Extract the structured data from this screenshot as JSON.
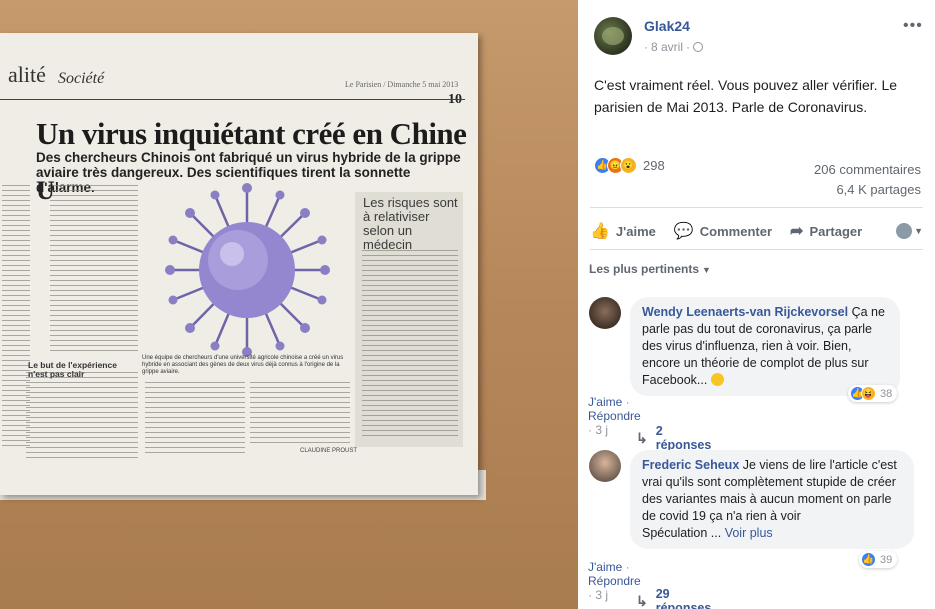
{
  "photo": {
    "section_title": "alité",
    "section_sub": "Société",
    "paper_header": "Le Parisien / Dimanche 5 mai 2013",
    "page_number": "10",
    "headline": "Un virus inquiétant créé en Chine",
    "subhead": "Des chercheurs Chinois ont fabriqué un virus hybride de la grippe aviaire très dangereux. Des scientifiques tirent la sonnette d'alarme.",
    "sidebar_title": "Les risques sont à relativiser selon un médecin",
    "side_subhead": "Le but de l'expérience n'est pas clair",
    "caption": "Une équipe de chercheurs d'une université agricole chinoise a créé un virus hybride en associant des gènes de deux virus déjà connus à l'origine de la grippe aviaire.",
    "credit": "CLAUDINE PROUST"
  },
  "post": {
    "author": "Glak24",
    "date": "8 avril",
    "text": "C'est vraiment réel. Vous pouvez aller vérifier. Le parisien de Mai 2013. Parle de Coronavirus.",
    "reaction_count": "298",
    "comments_count": "206 commentaires",
    "shares_count": "6,4 K partages",
    "actions": {
      "like": "J'aime",
      "comment": "Commenter",
      "share": "Partager"
    },
    "sort_label": "Les plus pertinents"
  },
  "comments": [
    {
      "name": "Wendy Leenaerts-van Rijckevorsel",
      "text": "Ça ne parle pas du tout de coronavirus, ça parle des virus d'influenza, rien à voir. Bien, encore un théorie de complot de plus sur Facebook...",
      "reaction_count": "38",
      "like": "J'aime",
      "reply": "Répondre",
      "time": "3 j",
      "replies": "2 réponses"
    },
    {
      "name": "Frederic Seheux",
      "text": "Je viens de lire l'article c'est vrai qu'ils sont complètement stupide de créer des variantes mais à aucun moment on parle de covid 19 ça n'a rien à voir",
      "text2": "Spéculation ...",
      "see_more": "Voir plus",
      "reaction_count": "39",
      "like": "J'aime",
      "reply": "Répondre",
      "time": "3 j",
      "replies": "29 réponses"
    }
  ]
}
